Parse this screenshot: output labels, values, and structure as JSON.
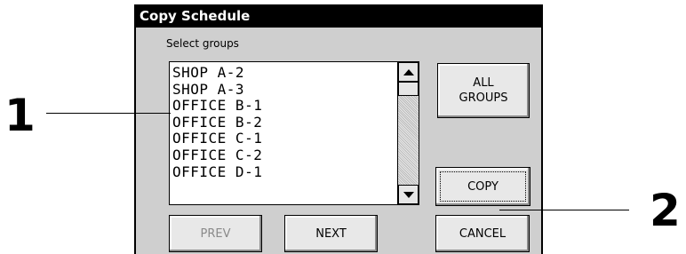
{
  "dialog": {
    "title": "Copy Schedule",
    "subtitle": "Select groups",
    "list": {
      "items": [
        "SHOP A-2",
        "SHOP A-3",
        "OFFICE B-1",
        "OFFICE B-2",
        "OFFICE C-1",
        "OFFICE C-2",
        "OFFICE D-1"
      ]
    },
    "buttons": {
      "all_groups_line1": "ALL",
      "all_groups_line2": "GROUPS",
      "copy": "COPY",
      "prev": "PREV",
      "next": "NEXT",
      "cancel": "CANCEL"
    }
  },
  "callouts": {
    "one": "1",
    "two": "2"
  },
  "colors": {
    "titlebar": "#000000",
    "dialog_bg": "#cfcfcf",
    "disabled_text": "#8a8a8a"
  }
}
